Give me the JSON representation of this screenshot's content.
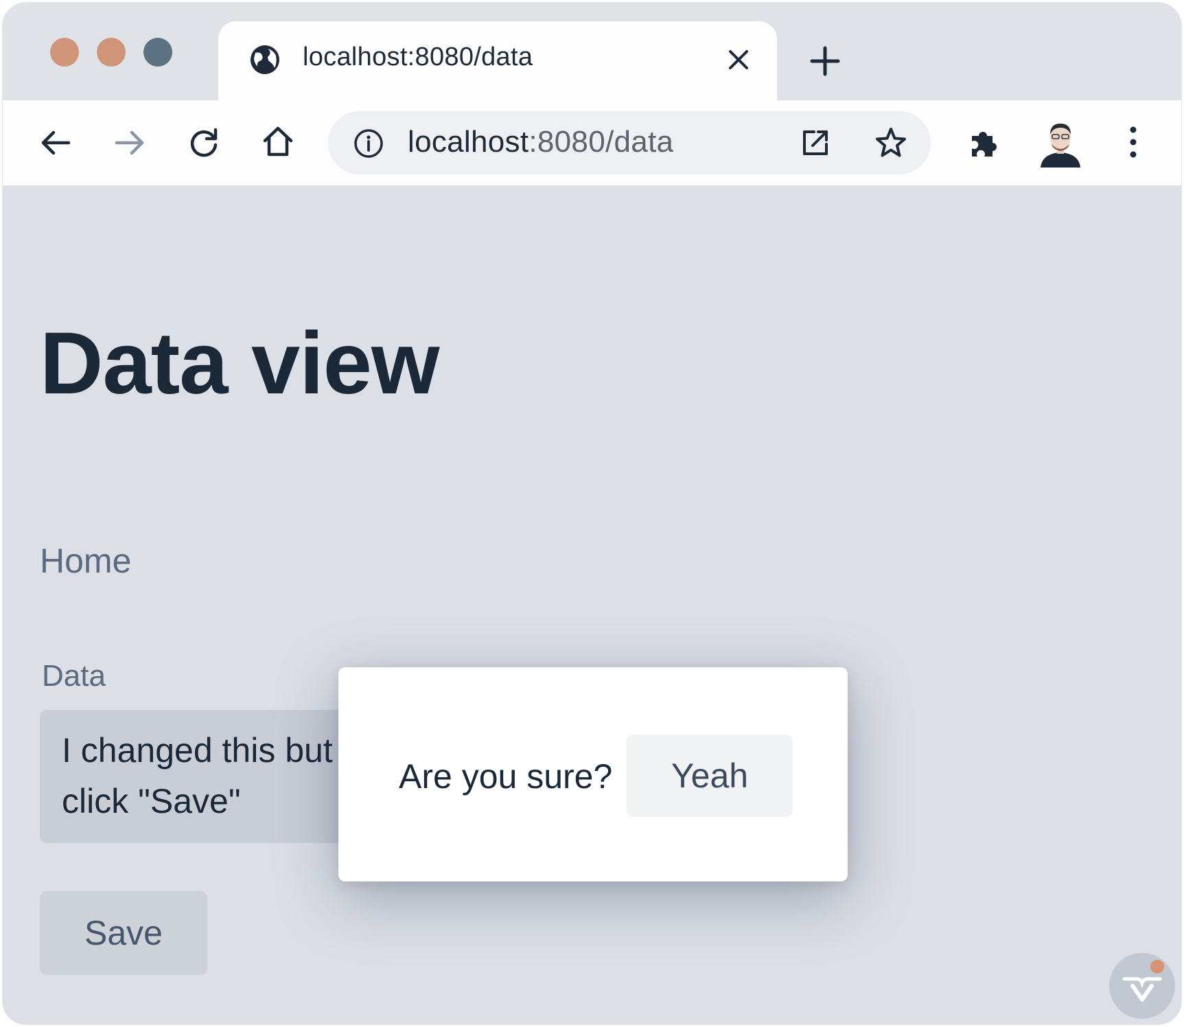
{
  "browser": {
    "tab_title": "localhost:8080/data",
    "url_host": "localhost",
    "url_path": ":8080/data"
  },
  "page": {
    "title": "Data view",
    "nav_home": "Home",
    "field_label": "Data",
    "field_value": "I changed this but didn't click \"Save\"",
    "save_label": "Save"
  },
  "dialog": {
    "message": "Are you sure?",
    "confirm_label": "Yeah"
  },
  "colors": {
    "accent_dot": "#d99272",
    "text_dark": "#1b2838"
  }
}
